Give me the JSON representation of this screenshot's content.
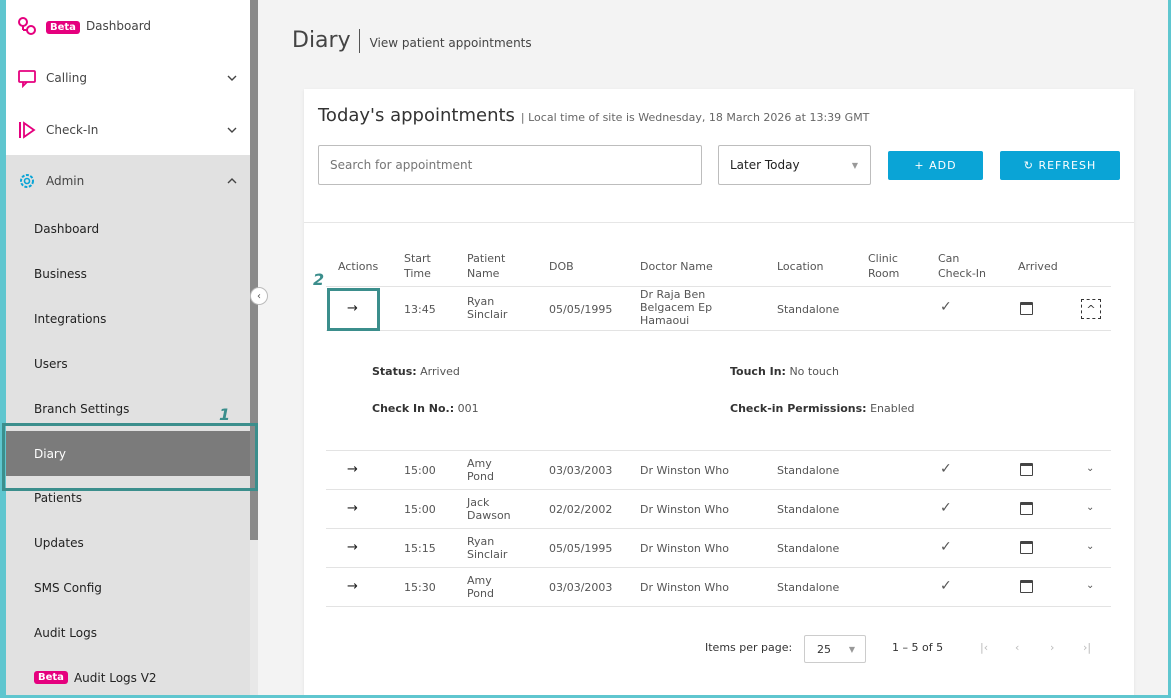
{
  "sidebar": {
    "top_items": [
      {
        "label": "Dashboard",
        "badge": "Beta",
        "icon": "logo-icon"
      },
      {
        "label": "Calling",
        "icon": "chat-icon"
      },
      {
        "label": "Check-In",
        "icon": "checkin-icon"
      },
      {
        "label": "Admin",
        "icon": "gear-icon"
      }
    ],
    "admin_items": [
      "Dashboard",
      "Business",
      "Integrations",
      "Users",
      "Branch Settings",
      "Diary",
      "Patients",
      "Updates",
      "SMS Config",
      "Audit Logs",
      "Audit Logs V2"
    ],
    "audit_v2_badge": "Beta",
    "active_item": "Diary"
  },
  "annotations": {
    "one": "1",
    "two": "2"
  },
  "page": {
    "title": "Diary",
    "subtitle": "View patient appointments"
  },
  "card": {
    "title": "Today's appointments",
    "local_time": "| Local time of site is Wednesday, 18 March 2026 at 13:39 GMT",
    "search_placeholder": "Search for appointment",
    "filter_value": "Later Today",
    "add_label": "+   ADD",
    "refresh_label": "↻   REFRESH"
  },
  "table": {
    "headers": [
      "Actions",
      "Start Time",
      "Patient Name",
      "DOB",
      "Doctor Name",
      "Location",
      "Clinic Room",
      "Can Check-In",
      "Arrived"
    ],
    "rows": [
      {
        "time": "13:45",
        "patient": "Ryan Sinclair",
        "dob": "05/05/1995",
        "doctor": "Dr Raja Ben Belgacem Ep Hamaoui",
        "location": "Standalone",
        "room": "",
        "can_checkin": true,
        "arrived": true,
        "expanded": true
      },
      {
        "time": "15:00",
        "patient": "Amy Pond",
        "dob": "03/03/2003",
        "doctor": "Dr Winston Who",
        "location": "Standalone",
        "room": "",
        "can_checkin": true,
        "arrived": false,
        "expanded": false
      },
      {
        "time": "15:00",
        "patient": "Jack Dawson",
        "dob": "02/02/2002",
        "doctor": "Dr Winston Who",
        "location": "Standalone",
        "room": "",
        "can_checkin": true,
        "arrived": false,
        "expanded": false
      },
      {
        "time": "15:15",
        "patient": "Ryan Sinclair",
        "dob": "05/05/1995",
        "doctor": "Dr Winston Who",
        "location": "Standalone",
        "room": "",
        "can_checkin": true,
        "arrived": false,
        "expanded": false
      },
      {
        "time": "15:30",
        "patient": "Amy Pond",
        "dob": "03/03/2003",
        "doctor": "Dr Winston Who",
        "location": "Standalone",
        "room": "",
        "can_checkin": true,
        "arrived": false,
        "expanded": false
      }
    ],
    "details": {
      "status_label": "Status:",
      "status_value": "Arrived",
      "touch_label": "Touch In:",
      "touch_value": "No touch",
      "checkin_label": "Check In No.:",
      "checkin_value": "001",
      "perm_label": "Check-in Permissions:",
      "perm_value": "Enabled"
    }
  },
  "pager": {
    "label": "Items per page:",
    "per_page": "25",
    "range": "1 – 5 of 5"
  },
  "colors": {
    "accent": "#0aa4d6",
    "badge": "#e5007e",
    "highlight": "#3b8e8c"
  }
}
